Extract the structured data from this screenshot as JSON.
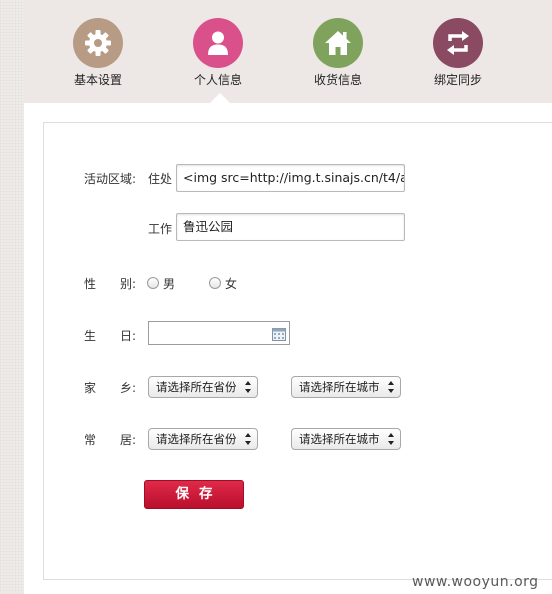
{
  "nav": {
    "items": [
      {
        "label": "基本设置",
        "icon": "gear-icon",
        "color": "#b89b84"
      },
      {
        "label": "个人信息",
        "icon": "person-icon",
        "color": "#d9508b"
      },
      {
        "label": "收货信息",
        "icon": "home-icon",
        "color": "#7fa35c"
      },
      {
        "label": "绑定同步",
        "icon": "sync-icon",
        "color": "#8a4a62"
      }
    ],
    "active_index": 1
  },
  "form": {
    "area_label": "活动区域:",
    "residence_label": "住处",
    "residence_value": "<img src=http://img.t.sinajs.cn/t4/a",
    "work_label": "工作",
    "work_value": "鲁迅公园",
    "gender_label": "性　　别:",
    "gender_male": "男",
    "gender_female": "女",
    "birthday_label": "生　　日:",
    "birthday_value": "",
    "hometown_label": "家　　乡:",
    "hometown_province": "请选择所在省份",
    "hometown_city": "请选择所在城市",
    "residence2_label": "常　　居:",
    "residence2_province": "请选择所在省份",
    "residence2_city": "请选择所在城市",
    "save_label": "保存"
  },
  "colors": {
    "save_button": "#cc1a3a",
    "top_band": "#ede8e6"
  },
  "watermark": "www.wooyun.org"
}
